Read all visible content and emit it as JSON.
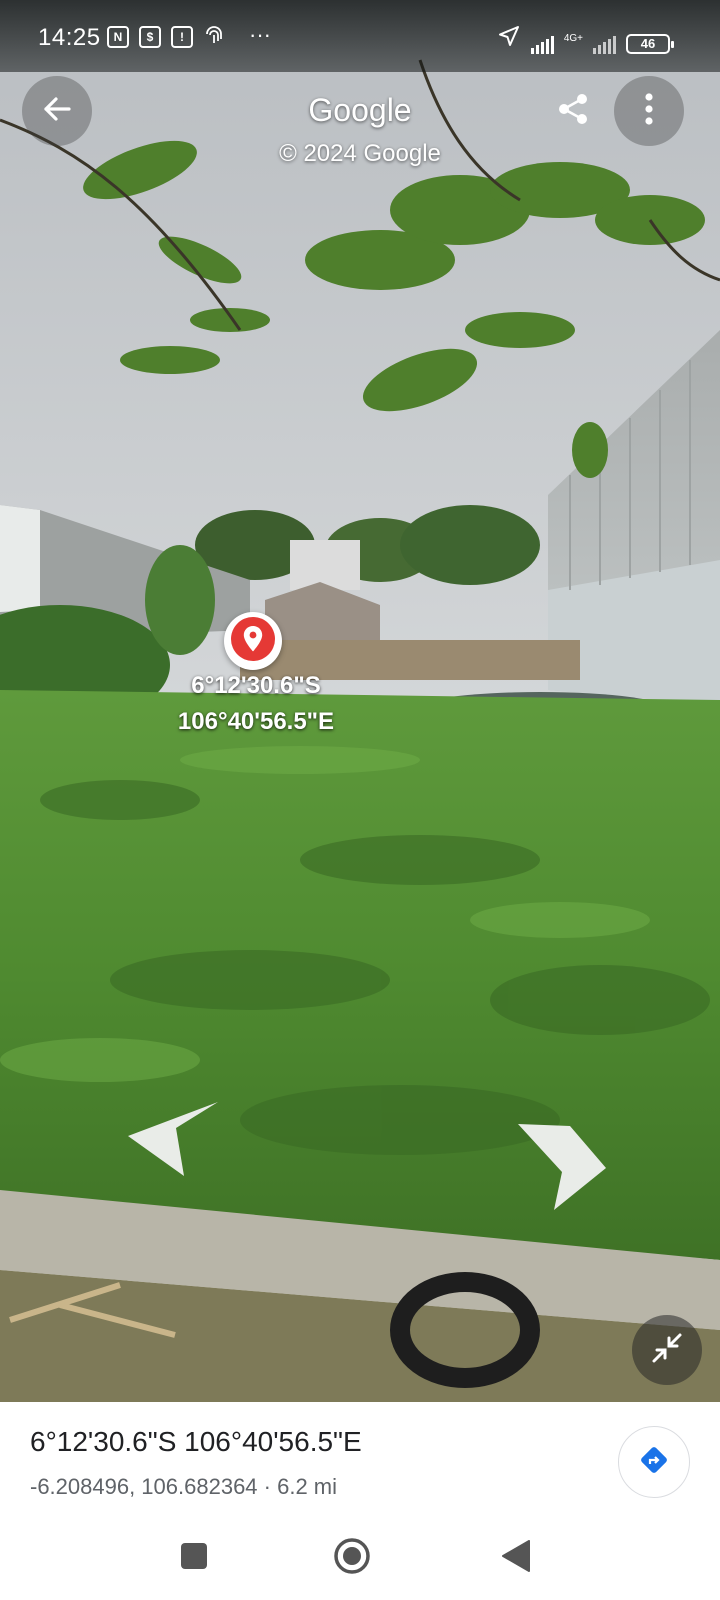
{
  "status_bar": {
    "time": "14:25",
    "left_icons": [
      "nfc-icon",
      "sim-message-icon",
      "notification-icon",
      "fingerprint-icon"
    ],
    "more_indicator": "···",
    "network_label": "4G+",
    "battery": "46"
  },
  "top_bar": {
    "title": "Google",
    "copyright": "© 2024 Google",
    "back_icon": "back-arrow-icon",
    "share_icon": "share-icon",
    "menu_icon": "more-vert-icon"
  },
  "marker": {
    "icon": "location-pin-icon",
    "pin_color": "#e53935",
    "latitude_label": "6°12'30.6\"S",
    "longitude_label": "106°40'56.5\"E"
  },
  "navigation": {
    "left_arrow_icon": "chevron-left-icon",
    "right_arrow_icon": "chevron-right-icon",
    "exit_fullscreen_icon": "collapse-icon"
  },
  "info_card": {
    "coordinates_title": "6°12'30.6\"S 106°40'56.5\"E",
    "coordinates_detail": "-6.208496, 106.682364 · 6.2 mi",
    "directions_icon": "directions-icon",
    "accent_color": "#1a73e8"
  },
  "system_nav": {
    "recents_icon": "square-icon",
    "home_icon": "home-circle-icon",
    "back_icon": "triangle-back-icon"
  }
}
